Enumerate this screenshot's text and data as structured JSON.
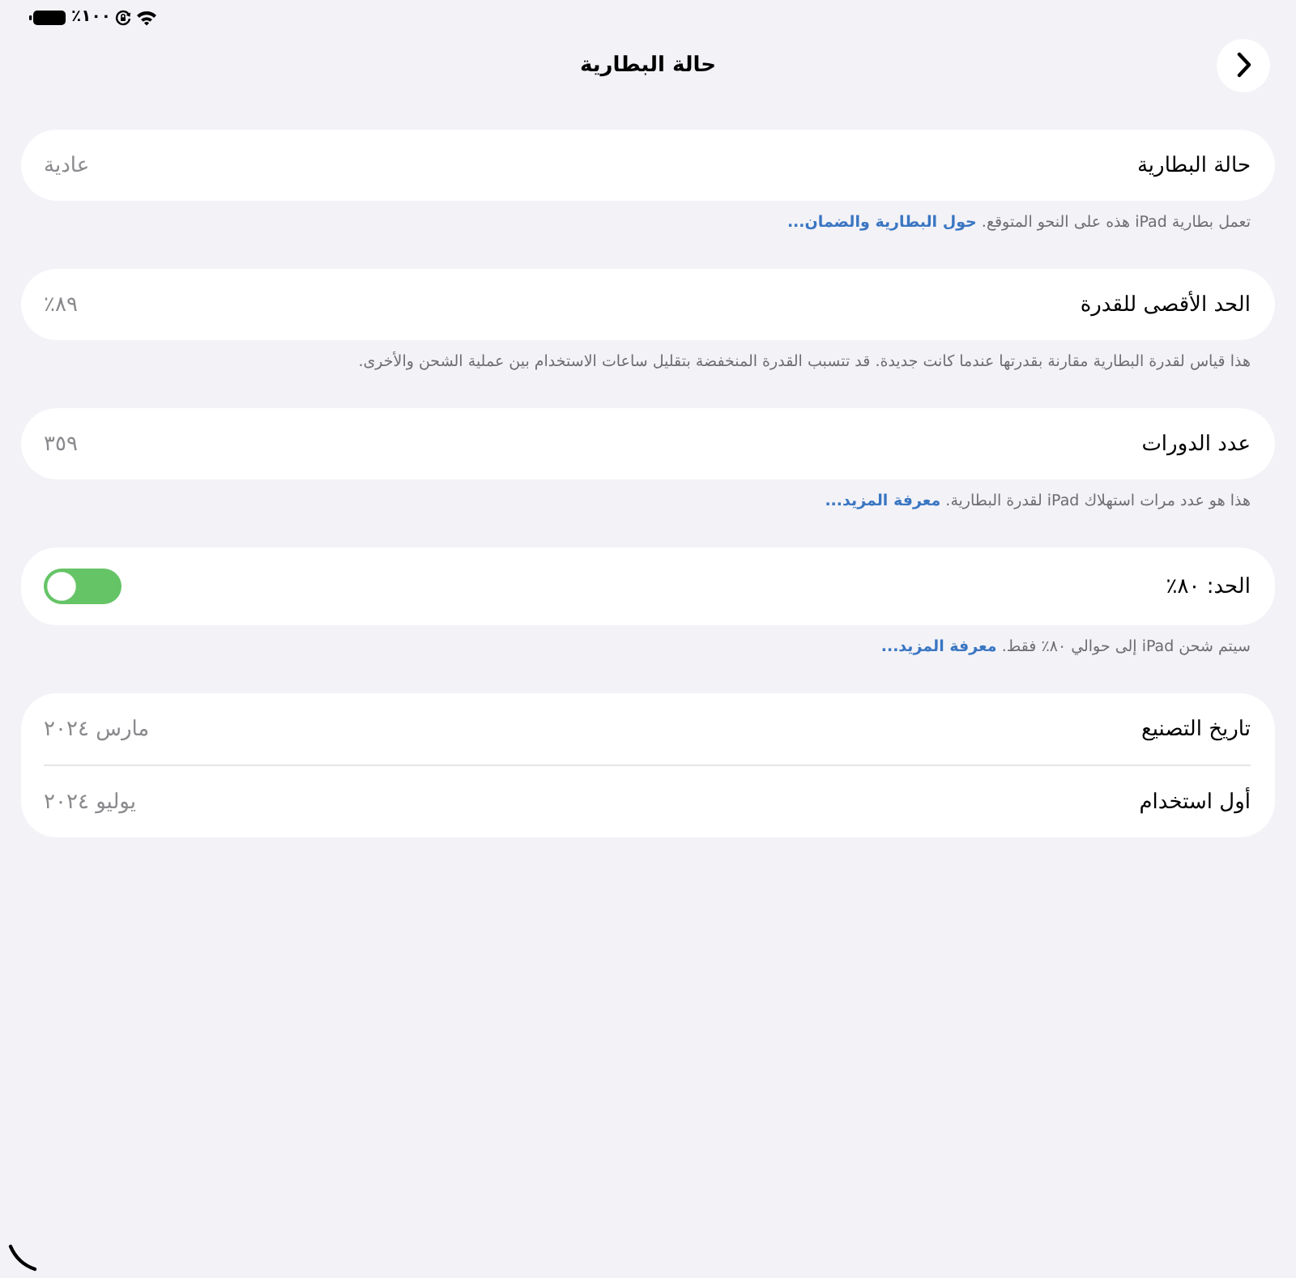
{
  "status_bar": {
    "battery": "١٠٠٪"
  },
  "header": {
    "title": "حالة البطارية"
  },
  "groups": [
    {
      "rows": [
        {
          "kind": "value",
          "label": "حالة البطارية",
          "value": "عادية"
        }
      ],
      "footnote": {
        "text": "تعمل بطارية iPad هذه على النحو المتوقع.",
        "link": "حول البطارية والضمان..."
      }
    },
    {
      "rows": [
        {
          "kind": "value",
          "label": "الحد الأقصى للقدرة",
          "value": "٨٩٪"
        }
      ],
      "footnote": {
        "text": "هذا قياس لقدرة البطارية مقارنة بقدرتها عندما كانت جديدة. قد تتسبب القدرة المنخفضة بتقليل ساعات الاستخدام بين عملية الشحن والأخرى."
      }
    },
    {
      "rows": [
        {
          "kind": "value",
          "label": "عدد الدورات",
          "value": "٣٥٩"
        }
      ],
      "footnote": {
        "text": "هذا هو عدد مرات استهلاك iPad لقدرة البطارية.",
        "link": "معرفة المزيد..."
      }
    },
    {
      "rows": [
        {
          "kind": "toggle",
          "label": "الحد: ٨٠٪",
          "on": true
        }
      ],
      "footnote": {
        "text": "سيتم شحن iPad إلى حوالي ٨٠٪ فقط.",
        "link": "معرفة المزيد..."
      }
    },
    {
      "rows": [
        {
          "kind": "value",
          "label": "تاريخ التصنيع",
          "value": "مارس ٢٠٢٤"
        },
        {
          "kind": "value",
          "label": "أول استخدام",
          "value": "يوليو ٢٠٢٤"
        }
      ]
    }
  ]
}
